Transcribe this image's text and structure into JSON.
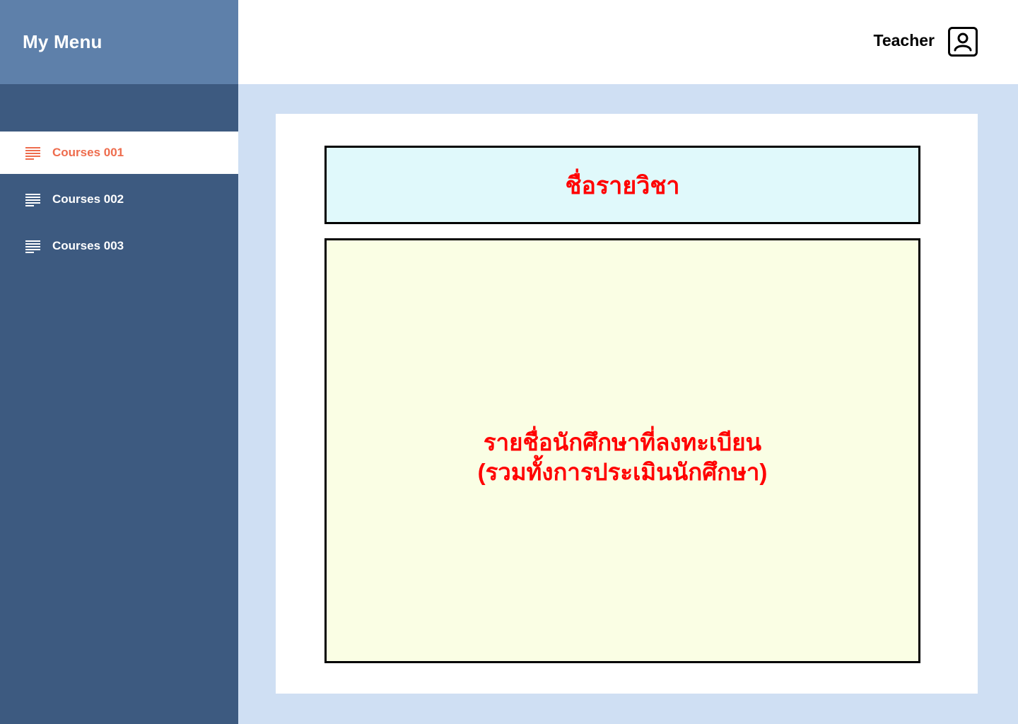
{
  "sidebar": {
    "title": "My Menu",
    "items": [
      {
        "label": "Courses 001",
        "icon": "list-icon",
        "active": true
      },
      {
        "label": "Courses 002",
        "icon": "list-icon",
        "active": false
      },
      {
        "label": "Courses 003",
        "icon": "list-icon",
        "active": false
      }
    ]
  },
  "header": {
    "user_role": "Teacher",
    "user_icon": "user-profile-icon"
  },
  "main": {
    "course_name_placeholder": "ชื่อรายวิชา",
    "student_list_line1": "รายชื่อนักศึกษาที่ลงทะเบียน",
    "student_list_line2": "(รวมทั้งการประเมินนักศึกษา)"
  },
  "colors": {
    "sidebar_bg": "#3d5a80",
    "sidebar_header_bg": "#5e80aa",
    "active_accent": "#ee6c4d",
    "page_bg": "#cfdff3",
    "placeholder_text": "#ff0000",
    "course_box_bg": "#e0f9fb",
    "student_box_bg": "#fafee4"
  }
}
